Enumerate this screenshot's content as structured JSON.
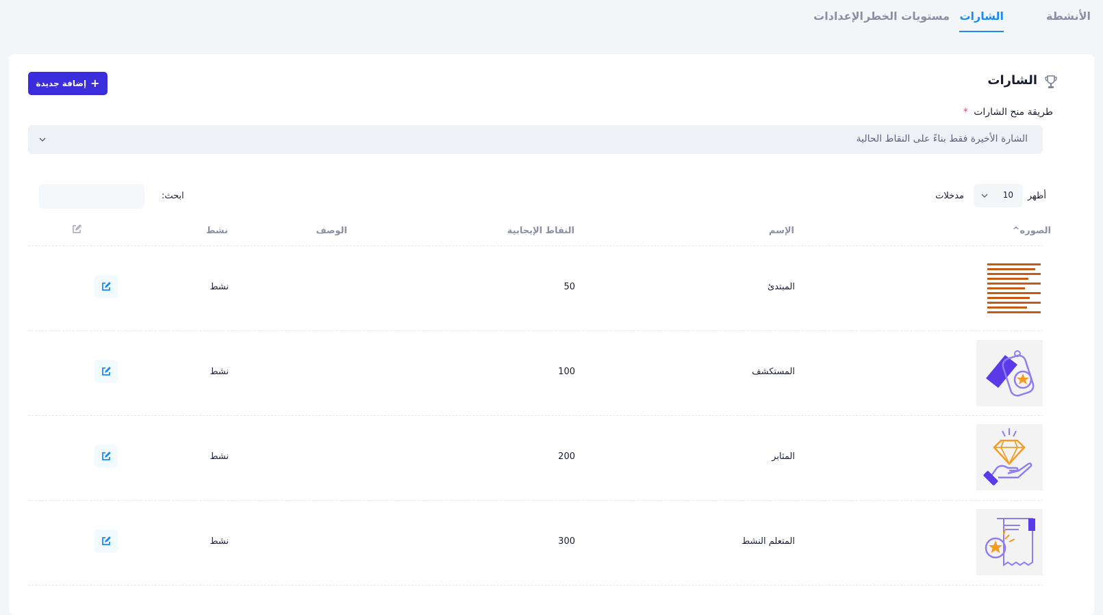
{
  "tabs": [
    {
      "label": "الأنشطة",
      "active": false
    },
    {
      "label": "الشارات",
      "active": true
    },
    {
      "label": "مستويات الخطر",
      "active": false
    },
    {
      "label": "الإعدادات",
      "active": false
    }
  ],
  "card": {
    "title": "الشارات",
    "add_button": "إضافة جديدة",
    "award_method": {
      "label": "طريقة منح الشارات",
      "required_mark": "*",
      "selected": "الشارة الأخيرة فقط بناءً على النقاط الحالية"
    },
    "table_controls": {
      "show_label": "أظهر",
      "entries_value": "10",
      "entries_label": "مدخلات",
      "search_label": "ابحث:"
    },
    "columns": {
      "image": "الصوره",
      "name": "الإسم",
      "points": "النقاط الإيجابية",
      "description": "الوصف",
      "status": "نشط"
    },
    "rows": [
      {
        "name": "المبتدئ",
        "points": "50",
        "description": "",
        "status": "نشط",
        "image_icon": "striped-badge-icon"
      },
      {
        "name": "المستكشف",
        "points": "100",
        "description": "",
        "status": "نشط",
        "image_icon": "tag-star-badge-icon"
      },
      {
        "name": "المثابر",
        "points": "200",
        "description": "",
        "status": "نشط",
        "image_icon": "diamond-hand-badge-icon"
      },
      {
        "name": "المتعلم النشط",
        "points": "300",
        "description": "",
        "status": "نشط",
        "image_icon": "certificate-star-badge-icon"
      }
    ]
  },
  "colors": {
    "accent": "#1a8bf0",
    "primary_button": "#3b2ddb",
    "required": "#f1416c",
    "badge_orange": "#c65a12",
    "badge_purple": "#5b3be8",
    "badge_star": "#f39c23"
  }
}
